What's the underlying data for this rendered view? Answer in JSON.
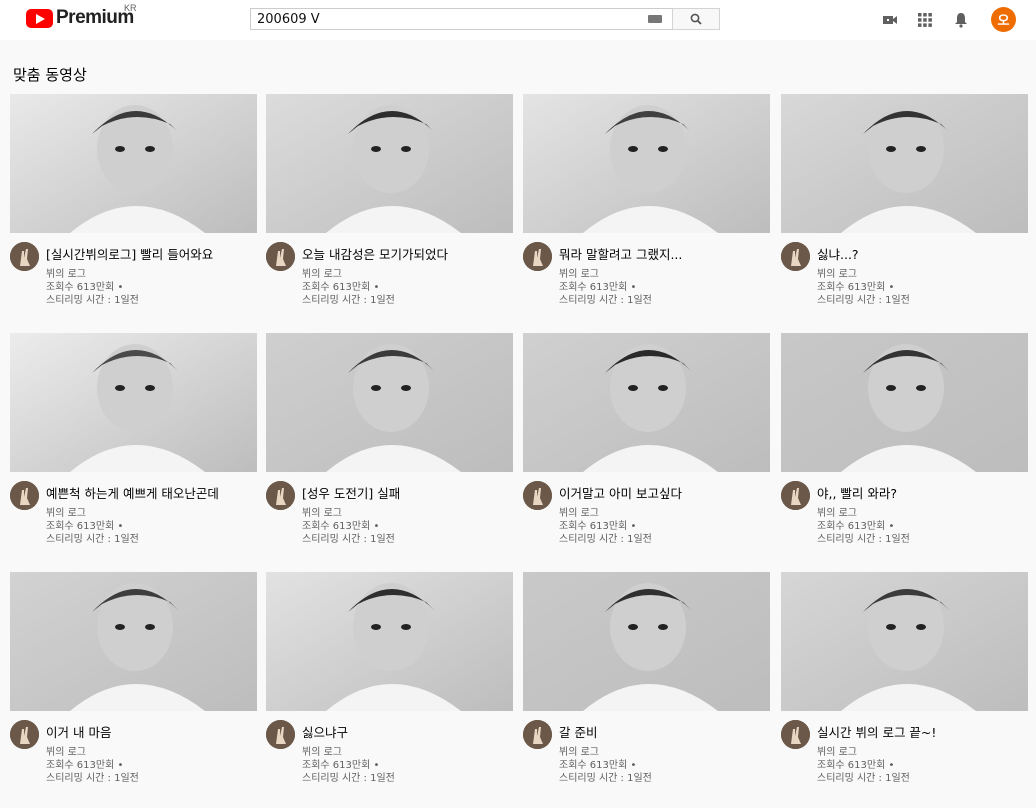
{
  "header": {
    "brand": "Premium",
    "region": "KR",
    "search_value": "200609 V",
    "avatar_letter": "오"
  },
  "section": {
    "title": "맞춤 동영상"
  },
  "videos": [
    {
      "title": "[실시간뷔의로그] 빨리 들어와요",
      "channel": "뷔의 로그",
      "views": "조회수 613만회 •",
      "streamed": "스티리밍 시간 : 1일전"
    },
    {
      "title": "오늘 내감성은 모기가되었다",
      "channel": "뷔의 로그",
      "views": "조회수 613만회 •",
      "streamed": "스티리밍 시간 : 1일전"
    },
    {
      "title": "뭐라 말할려고 그랬지...",
      "channel": "뷔의 로그",
      "views": "조회수 613만회 •",
      "streamed": "스티리밍 시간 : 1일전"
    },
    {
      "title": "싫냐...?",
      "channel": "뷔의 로그",
      "views": "조회수 613만회 •",
      "streamed": "스티리밍 시간 : 1일전"
    },
    {
      "title": "예쁜척 하는게 예쁘게 태오난곤데",
      "channel": "뷔의 로그",
      "views": "조회수 613만회 •",
      "streamed": "스티리밍 시간 : 1일전"
    },
    {
      "title": "[성우 도전기] 실패",
      "channel": "뷔의 로그",
      "views": "조회수 613만회 •",
      "streamed": "스티리밍 시간 : 1일전"
    },
    {
      "title": "이거말고 아미 보고싶다",
      "channel": "뷔의 로그",
      "views": "조회수 613만회 •",
      "streamed": "스티리밍 시간 : 1일전"
    },
    {
      "title": "야,, 빨리 와라?",
      "channel": "뷔의 로그",
      "views": "조회수 613만회 •",
      "streamed": "스티리밍 시간 : 1일전"
    },
    {
      "title": "이거 내 마음",
      "channel": "뷔의 로그",
      "views": "조회수 613만회 •",
      "streamed": "스티리밍 시간 : 1일전"
    },
    {
      "title": "싫으냐구",
      "channel": "뷔의 로그",
      "views": "조회수 613만회 •",
      "streamed": "스티리밍 시간 : 1일전"
    },
    {
      "title": "갈 준비",
      "channel": "뷔의 로그",
      "views": "조회수 613만회 •",
      "streamed": "스티리밍 시간 : 1일전"
    },
    {
      "title": "실시간 뷔의 로그 끝~!",
      "channel": "뷔의 로그",
      "views": "조회수 613만회 •",
      "streamed": "스티리밍 시간 : 1일전"
    }
  ],
  "colors": {
    "brand_red": "#ff0000",
    "avatar_orange": "#ef6c00",
    "bg": "#f9f9f9"
  }
}
